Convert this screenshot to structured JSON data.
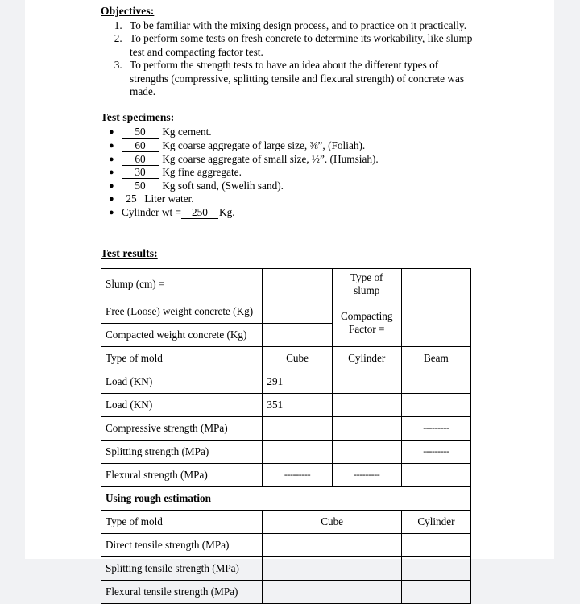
{
  "document": {
    "objectives": {
      "heading": "Objectives:",
      "items": [
        "To be familiar with the mixing design process, and to practice on it practically.",
        "To perform some tests on fresh concrete to determine its workability, like slump test and compacting factor test.",
        "To perform the strength tests to have an idea about the different types of strengths (compressive, splitting tensile and flexural strength) of concrete was made."
      ]
    },
    "specimens": {
      "heading": "Test specimens:",
      "bullet_glyph": "●",
      "items": [
        {
          "value": "50",
          "text": "Kg cement."
        },
        {
          "value": "60",
          "text": "Kg coarse aggregate of large size, ⅜”, (Foliah)."
        },
        {
          "value": "60",
          "text": "Kg coarse aggregate of small size, ½”. (Humsiah)."
        },
        {
          "value": "30",
          "text": "Kg fine aggregate."
        },
        {
          "value": "50",
          "text": "Kg soft sand, (Swelih sand)."
        },
        {
          "value": "25",
          "text": "Liter water."
        }
      ],
      "cylinder": {
        "prefix": "Cylinder wt =",
        "value": "250",
        "suffix": "Kg."
      }
    },
    "results": {
      "heading": "Test results:",
      "rows": [
        {
          "label": "Slump (cm) =",
          "c2": "",
          "c3": "Type of slump",
          "c4": ""
        },
        {
          "label": "Free (Loose) weight concrete (Kg)",
          "c2": "",
          "c3": "Compacting Factor =",
          "c4": ""
        },
        {
          "label": "Compacted weight concrete (Kg)",
          "c2": "",
          "c3": "",
          "c4": ""
        },
        {
          "label": "Type of mold",
          "c2": "Cube",
          "c3": "Cylinder",
          "c4": "Beam"
        },
        {
          "label": "Load (KN)",
          "c2": "291",
          "c3": "",
          "c4": ""
        },
        {
          "label": "Load (KN)",
          "c2": "351",
          "c3": "",
          "c4": ""
        },
        {
          "label": "Compressive strength (MPa)",
          "c2": "",
          "c3": "",
          "c4": "---------"
        },
        {
          "label": "Splitting strength (MPa)",
          "c2": "",
          "c3": "",
          "c4": "---------"
        },
        {
          "label": "Flexural strength (MPa)",
          "c2": "---------",
          "c3": "---------",
          "c4": ""
        }
      ],
      "rough_section_title": "Using rough estimation",
      "rough_rows": [
        {
          "label": "Type of mold",
          "c2": "Cube",
          "c3": "Cylinder"
        },
        {
          "label": "Direct tensile strength (MPa)",
          "c2": "",
          "c3": ""
        },
        {
          "label": "Splitting tensile strength (MPa)",
          "c2": "",
          "c3": ""
        },
        {
          "label": "Flexural tensile strength (MPa)",
          "c2": "",
          "c3": ""
        }
      ]
    }
  },
  "colors": {
    "page_background": "#ffffff",
    "canvas_background": "#f1f2f4",
    "text": "#000000",
    "table_border": "#000000"
  }
}
